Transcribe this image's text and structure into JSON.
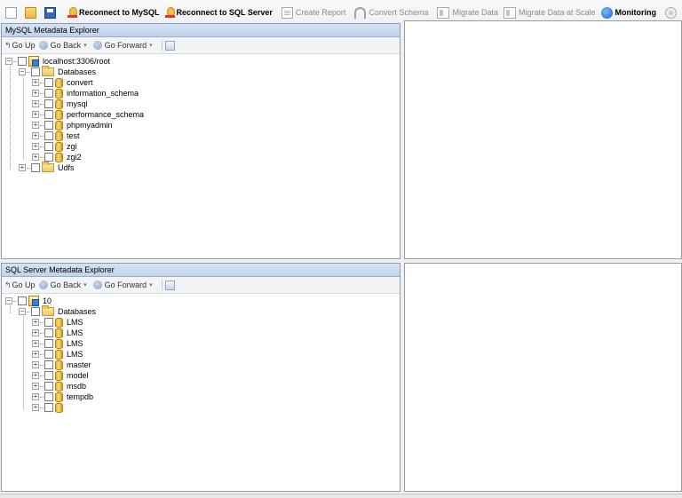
{
  "toolbar": {
    "reconnect_mysql": "Reconnect to MySQL",
    "reconnect_sqlserver": "Reconnect to SQL Server",
    "create_report": "Create Report",
    "convert_schema": "Convert Schema",
    "migrate_data": "Migrate Data",
    "migrate_data_scale": "Migrate Data at Scale",
    "monitoring": "Monitoring"
  },
  "mysql_explorer": {
    "title": "MySQL Metadata Explorer",
    "nav": {
      "go_up": "Go Up",
      "go_back": "Go Back",
      "go_forward": "Go Forward"
    },
    "root": "localhost:3306/root",
    "databases_label": "Databases",
    "databases": [
      "convert",
      "information_schema",
      "mysql",
      "performance_schema",
      "phpmyadmin",
      "test",
      "zgi",
      "zgi2"
    ],
    "udfs_label": "Udfs"
  },
  "sqlserver_explorer": {
    "title": "SQL Server Metadata Explorer",
    "nav": {
      "go_up": "Go Up",
      "go_back": "Go Back",
      "go_forward": "Go Forward"
    },
    "root": "10",
    "databases_label": "Databases",
    "databases": [
      "LMS",
      "LMS",
      "LMS",
      "LMS",
      "master",
      "model",
      "msdb",
      "tempdb",
      ""
    ]
  }
}
